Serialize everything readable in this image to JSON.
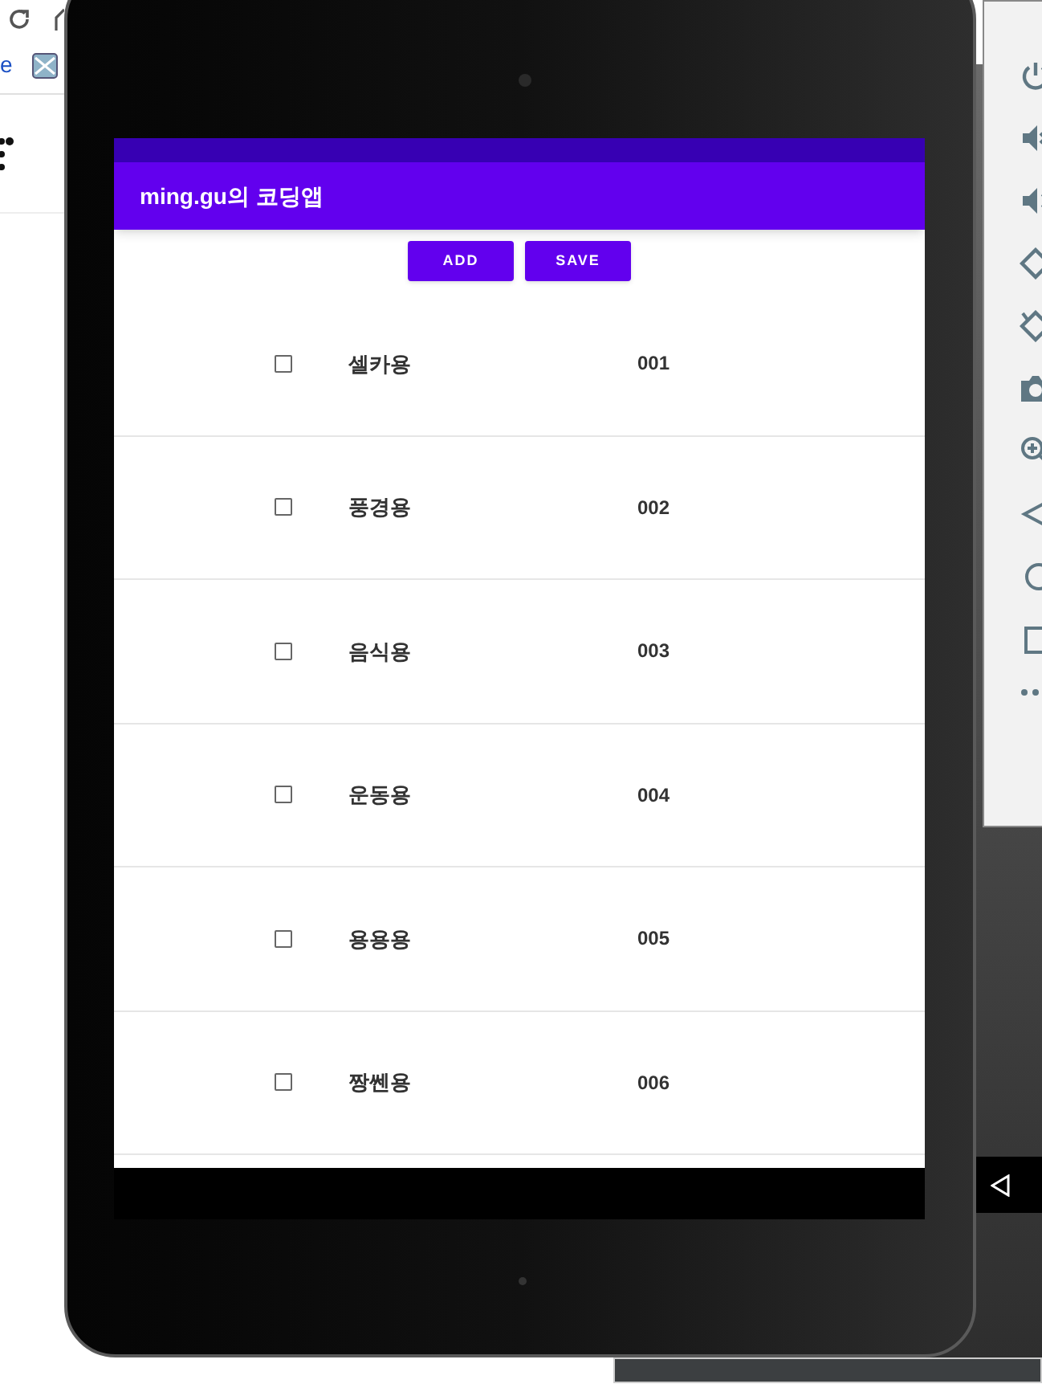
{
  "browser": {
    "link_text": "e"
  },
  "app_bar": {
    "title": "ming.gu의 코딩앱"
  },
  "buttons": [
    {
      "label": "ADD"
    },
    {
      "label": "SAVE"
    }
  ],
  "items": [
    {
      "name": "셀카용",
      "code": "001",
      "checked": false
    },
    {
      "name": "풍경용",
      "code": "002",
      "checked": false
    },
    {
      "name": "음식용",
      "code": "003",
      "checked": false
    },
    {
      "name": "운동용",
      "code": "004",
      "checked": false
    },
    {
      "name": "용용용",
      "code": "005",
      "checked": false
    },
    {
      "name": "짱쎈용",
      "code": "006",
      "checked": false
    }
  ]
}
